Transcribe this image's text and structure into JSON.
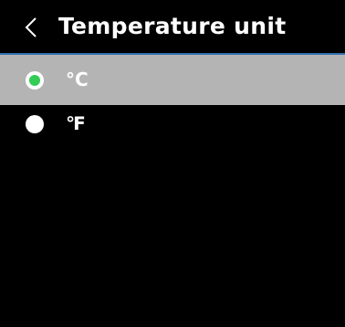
{
  "header": {
    "title": "Temperature unit",
    "back_icon": "chevron-left-icon"
  },
  "options": [
    {
      "label": "°C",
      "selected": true
    },
    {
      "label": "℉",
      "selected": false
    }
  ],
  "colors": {
    "background": "#000000",
    "selected_row": "#b4b4b4",
    "divider": "#2e6fb0",
    "radio_selected_dot": "#33cc55",
    "radio_unselected": "#ffffff"
  }
}
